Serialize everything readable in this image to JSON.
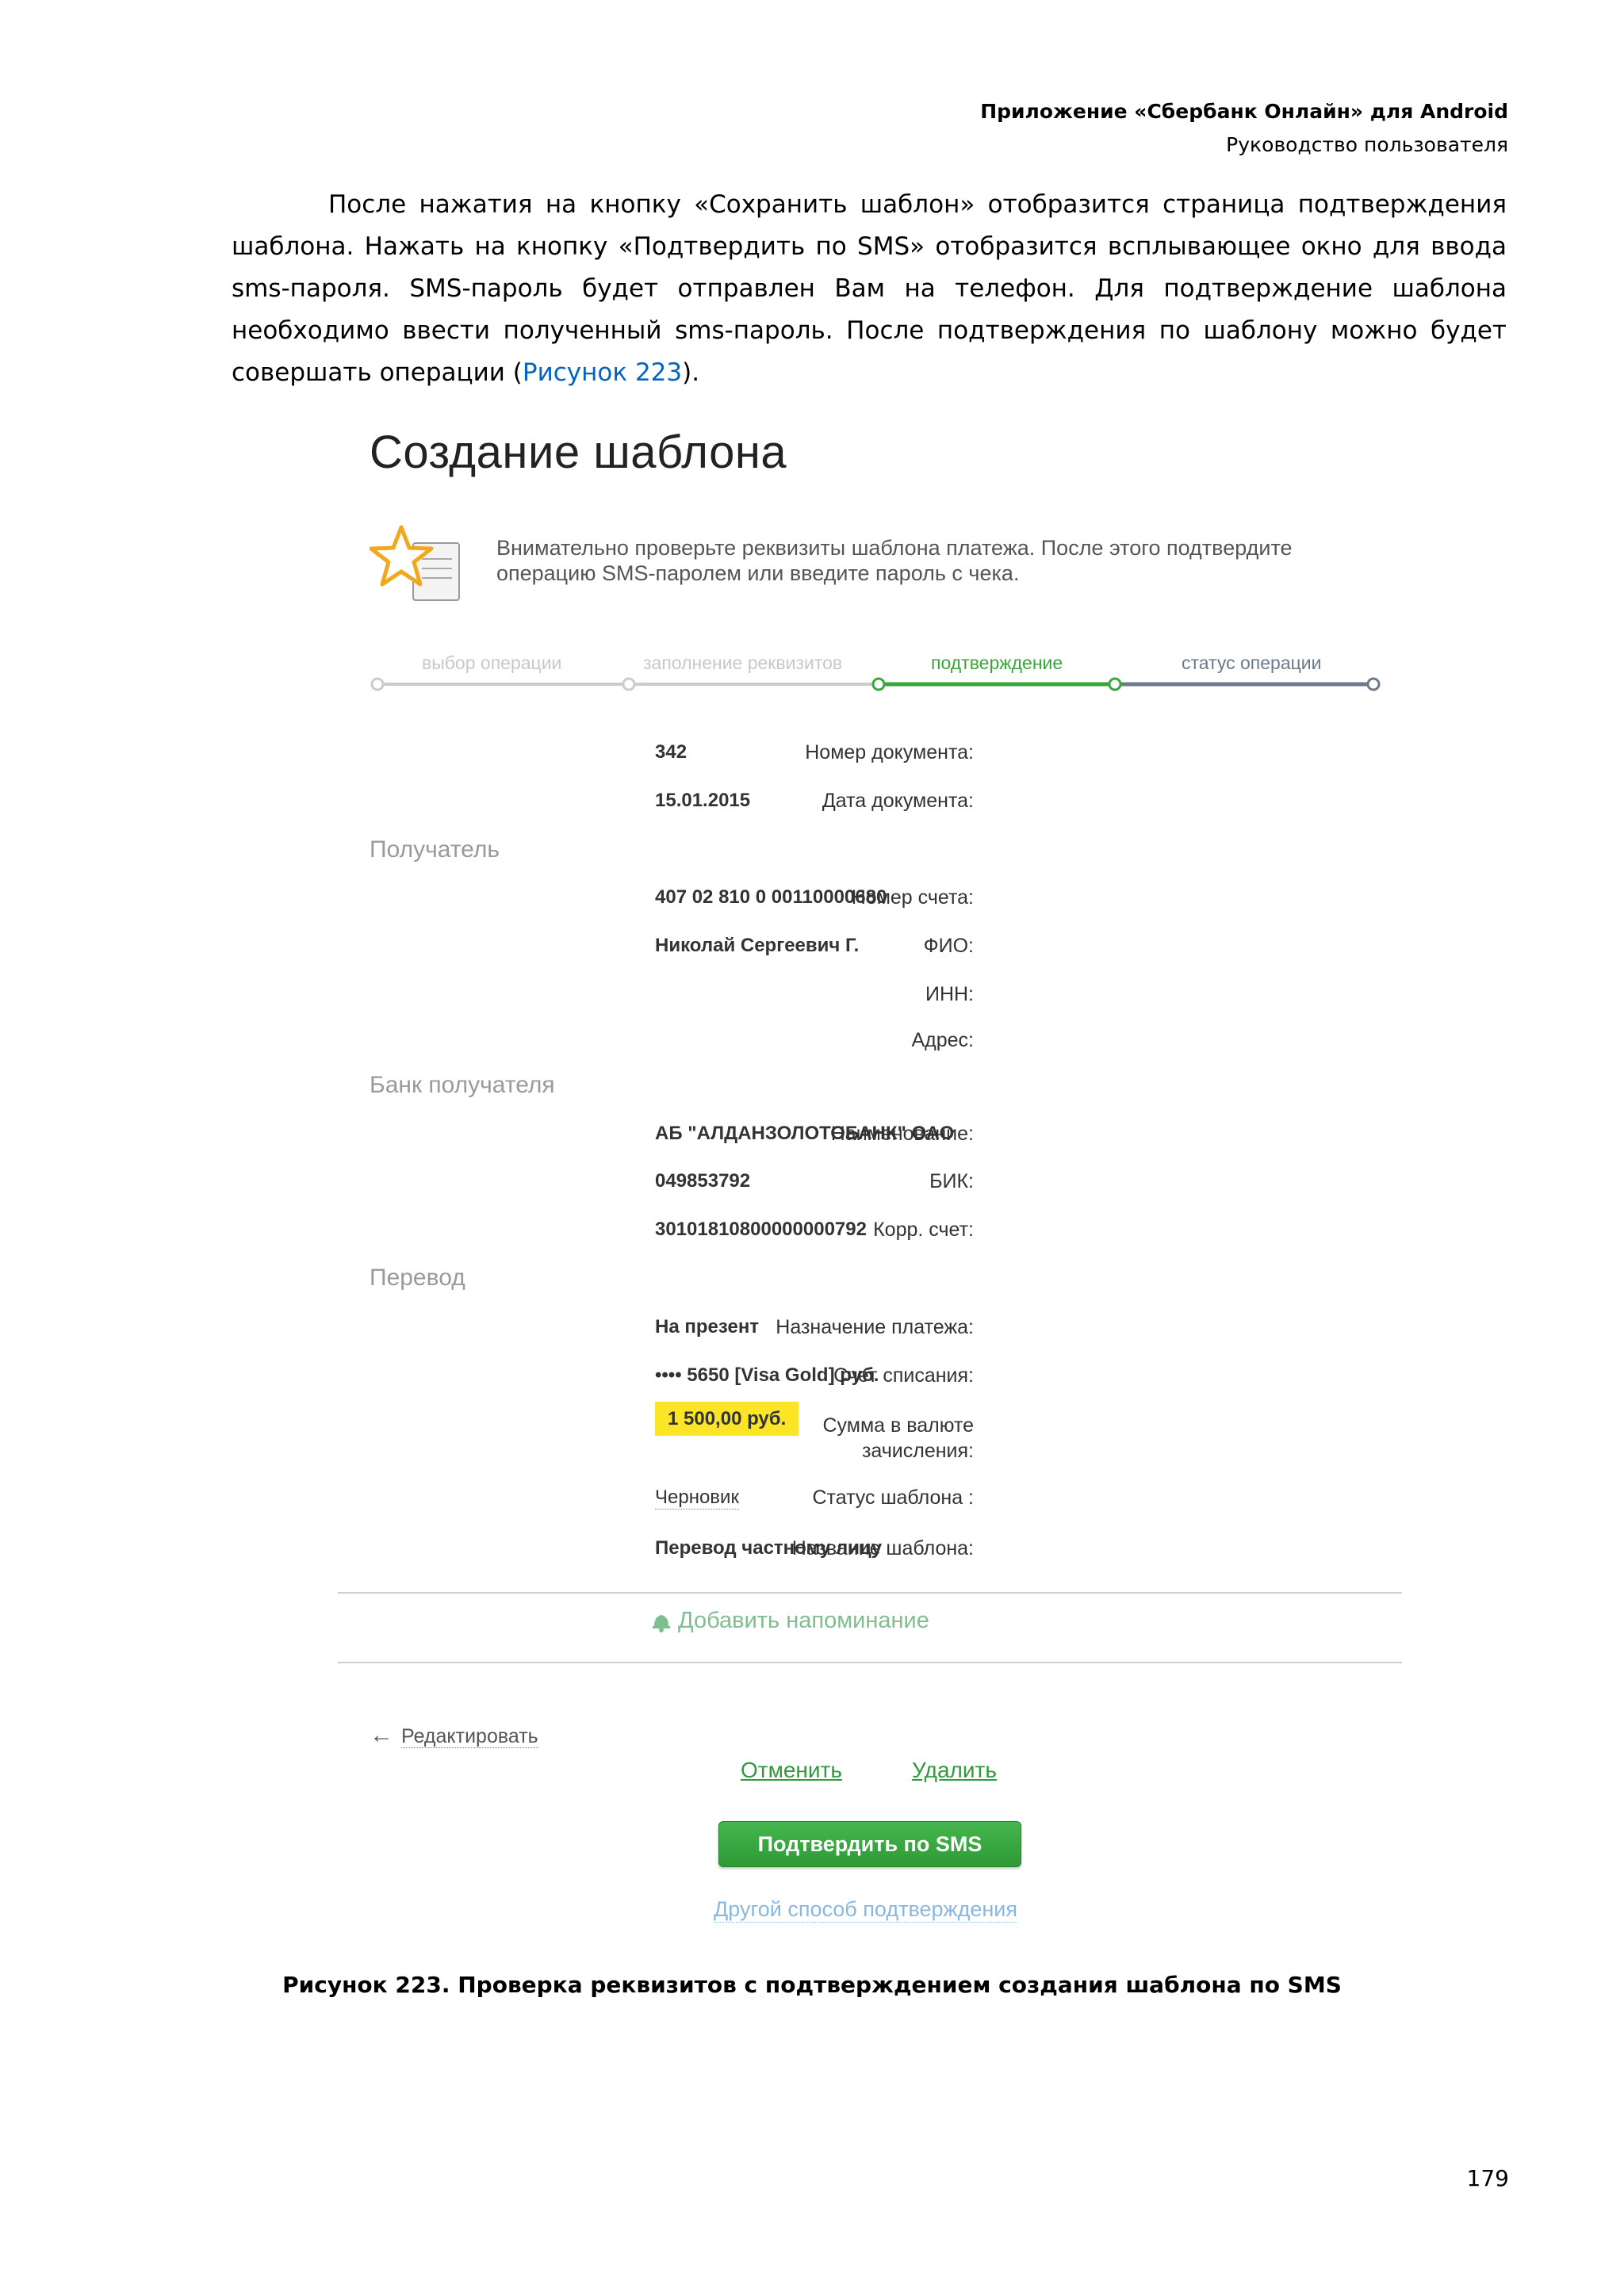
{
  "doc_header": {
    "title": "Приложение «Сбербанк Онлайн» для Android",
    "subtitle": "Руководство пользователя"
  },
  "intro": {
    "text_before_link": "После нажатия на кнопку «Сохранить шаблон» отобразится страница подтверждения шаблона. Нажать на кнопку «Подтвердить по SMS» отобразится всплывающее окно для ввода sms-пароля. SMS-пароль будет отправлен Вам на телефон. Для подтверждение шаблона необходимо ввести полученный sms-пароль. После подтверждения по шаблону можно будет совершать операции (",
    "link": "Рисунок 223",
    "text_after_link": ")."
  },
  "screen": {
    "title": "Создание шаблона",
    "notice": "Внимательно проверьте реквизиты шаблона платежа. После этого подтвердите операцию SMS-паролем или введите пароль с чека.",
    "steps": [
      {
        "label": "выбор операции",
        "state": "done"
      },
      {
        "label": "заполнение реквизитов",
        "state": "done"
      },
      {
        "label": "подтверждение",
        "state": "active"
      },
      {
        "label": "статус операции",
        "state": "pending"
      }
    ],
    "doc_fields": [
      {
        "label": "Номер документа:",
        "value": "342"
      },
      {
        "label": "Дата документа:",
        "value": "15.01.2015"
      }
    ],
    "recipient": {
      "heading": "Получатель",
      "fields": [
        {
          "label": "Номер счета:",
          "value": "407 02 810 0 00110000680"
        },
        {
          "label": "ФИО:",
          "value": "Николай Сергеевич Г."
        },
        {
          "label": "ИНН:",
          "value": ""
        },
        {
          "label": "Адрес:",
          "value": ""
        }
      ]
    },
    "bank": {
      "heading": "Банк получателя",
      "fields": [
        {
          "label": "Наименование:",
          "value": "АБ \"АЛДАНЗОЛОТОБАНК\" ОАО"
        },
        {
          "label": "БИК:",
          "value": "049853792"
        },
        {
          "label": "Корр. счет:",
          "value": "30101810800000000792"
        }
      ]
    },
    "transfer": {
      "heading": "Перевод",
      "purpose_label": "Назначение платежа:",
      "purpose_value": "На презент",
      "account_label": "Счет списания:",
      "account_value": "•••• 5650  [Visa Gold]  руб.",
      "amount_label_1": "Сумма в валюте",
      "amount_label_2": "зачисления:",
      "amount_value": "1 500,00  руб.",
      "status_label": "Статус шаблона :",
      "status_value": "Черновик",
      "name_label": "Название шаблона:",
      "name_value": "Перевод частному лицу"
    },
    "reminder": "Добавить напоминание",
    "edit_link": "Редактировать",
    "cancel_link": "Отменить",
    "delete_link": "Удалить",
    "confirm_button": "Подтвердить по SMS",
    "other_method_link": "Другой способ подтверждения",
    "colors": {
      "accent_green": "#2e9a36",
      "step_done": "#cccccc",
      "step_active": "#3aa63a",
      "step_pending": "#6a7a8a",
      "highlight": "#fbe526"
    }
  },
  "caption": "Рисунок 223. Проверка реквизитов с подтверждением создания шаблона по SMS",
  "page_number": "179"
}
